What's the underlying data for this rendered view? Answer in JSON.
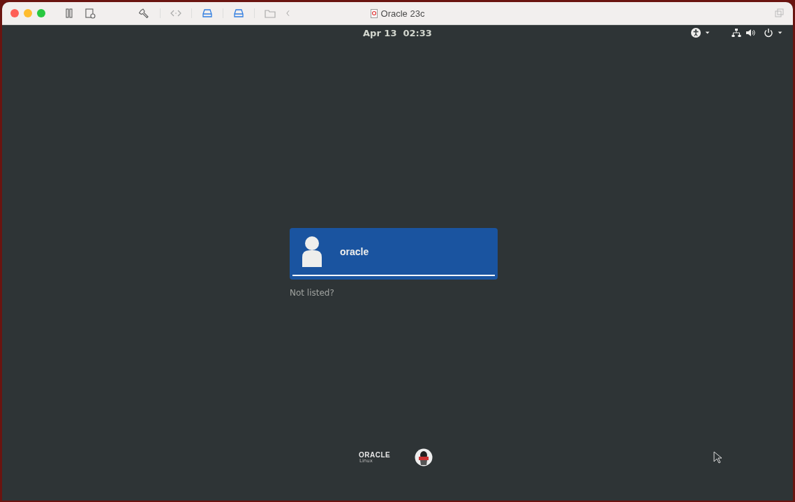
{
  "window": {
    "title": "Oracle 23c"
  },
  "top_bar": {
    "date": "Apr 13",
    "time": "02:33"
  },
  "login": {
    "users": [
      {
        "name": "oracle",
        "selected": true
      }
    ],
    "not_listed": "Not listed?"
  },
  "branding": {
    "logo": "ORACLE",
    "sub": "Linux"
  }
}
